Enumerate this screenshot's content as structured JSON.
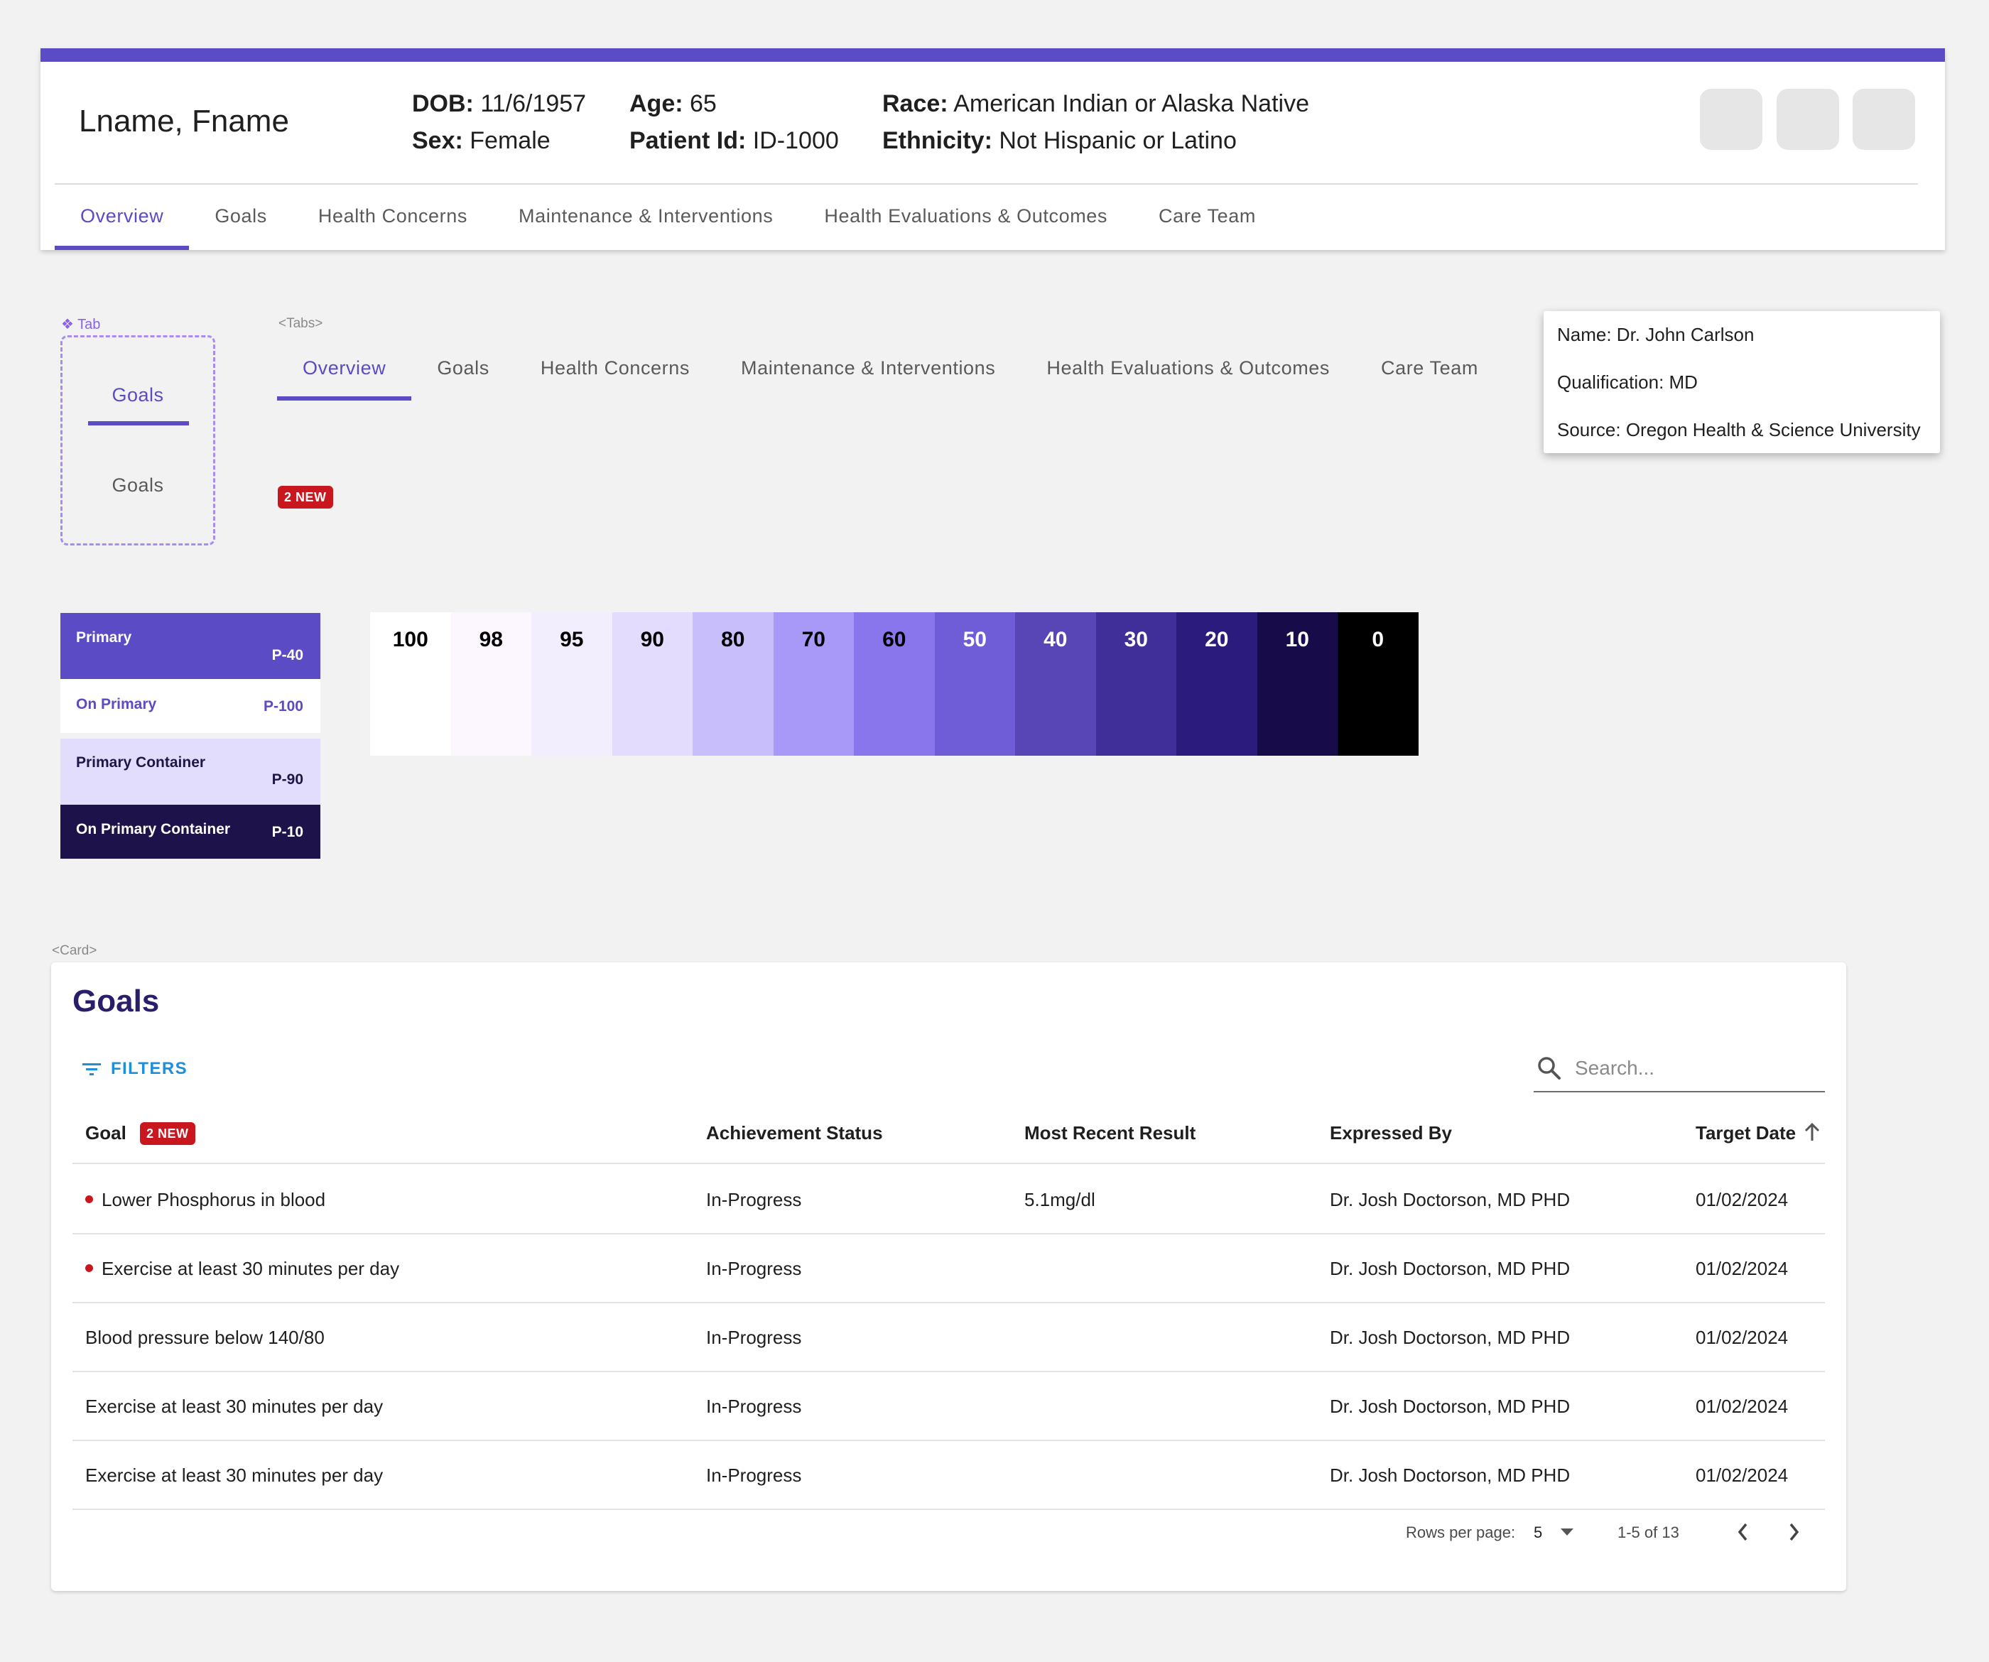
{
  "patient": {
    "name": "Lname, Fname",
    "dob_label": "DOB:",
    "dob": "11/6/1957",
    "sex_label": "Sex:",
    "sex": "Female",
    "age_label": "Age:",
    "age": "65",
    "id_label": "Patient Id:",
    "id": "ID-1000",
    "race_label": "Race:",
    "race": "American Indian or Alaska Native",
    "ethnicity_label": "Ethnicity:",
    "ethnicity": "Not Hispanic or Latino"
  },
  "header_tabs": [
    "Overview",
    "Goals",
    "Health Concerns",
    "Maintenance & Interventions",
    "Health Evaluations & Outcomes",
    "Care Team"
  ],
  "spec": {
    "tab_component_label": "❖ Tab",
    "tab_active": "Goals",
    "tab_inactive": "Goals",
    "tabs_component_label": "<Tabs>",
    "tabs": [
      "Overview",
      "Goals",
      "Health Concerns",
      "Maintenance & Interventions",
      "Health Evaluations & Outcomes",
      "Care Team"
    ],
    "badge": "2 NEW",
    "card_component_label": "<Card>"
  },
  "tooltip": {
    "name": "Name: Dr. John Carlson",
    "qualification": "Qualification: MD",
    "source": "Source: Oregon Health & Science University"
  },
  "roles": [
    {
      "name": "Primary",
      "code": "P-40",
      "bg": "#5b4bc4",
      "fg": "#ffffff"
    },
    {
      "name": "On Primary",
      "code": "P-100",
      "bg": "#ffffff",
      "fg": "#5b4bc4"
    },
    {
      "name": "Primary Container",
      "code": "P-90",
      "bg": "#e2dcfd",
      "fg": "#1f1646"
    },
    {
      "name": "On Primary Container",
      "code": "P-10",
      "bg": "#1d1249",
      "fg": "#ffffff"
    }
  ],
  "palette": [
    {
      "tone": "100",
      "bg": "#ffffff",
      "fg": "#000000"
    },
    {
      "tone": "98",
      "bg": "#fcf7ff",
      "fg": "#000000"
    },
    {
      "tone": "95",
      "bg": "#f3eefe",
      "fg": "#000000"
    },
    {
      "tone": "90",
      "bg": "#e4dcfd",
      "fg": "#000000"
    },
    {
      "tone": "80",
      "bg": "#c8befb",
      "fg": "#000000"
    },
    {
      "tone": "70",
      "bg": "#a898f8",
      "fg": "#000000"
    },
    {
      "tone": "60",
      "bg": "#8a76ec",
      "fg": "#000000"
    },
    {
      "tone": "50",
      "bg": "#6f5cd7",
      "fg": "#ffffff"
    },
    {
      "tone": "40",
      "bg": "#5846b7",
      "fg": "#ffffff"
    },
    {
      "tone": "30",
      "bg": "#402f99",
      "fg": "#ffffff"
    },
    {
      "tone": "20",
      "bg": "#2b1b7d",
      "fg": "#ffffff"
    },
    {
      "tone": "10",
      "bg": "#170b4a",
      "fg": "#ffffff"
    },
    {
      "tone": "0",
      "bg": "#000000",
      "fg": "#ffffff"
    }
  ],
  "goals": {
    "title": "Goals",
    "filters_label": "FILTERS",
    "search_placeholder": "Search...",
    "columns": {
      "goal": "Goal",
      "status": "Achievement Status",
      "result": "Most Recent Result",
      "by": "Expressed By",
      "date": "Target Date"
    },
    "badge": "2 NEW",
    "rows": [
      {
        "goal": "Lower Phosphorus in blood",
        "status": "In-Progress",
        "result": "5.1mg/dl",
        "by": "Dr. Josh Doctorson, MD PHD",
        "date": "01/02/2024",
        "new": true
      },
      {
        "goal": "Exercise at least 30 minutes per day",
        "status": "In-Progress",
        "result": "",
        "by": "Dr. Josh Doctorson, MD PHD",
        "date": "01/02/2024",
        "new": true
      },
      {
        "goal": "Blood pressure below 140/80",
        "status": "In-Progress",
        "result": "",
        "by": "Dr. Josh Doctorson, MD PHD",
        "date": "01/02/2024",
        "new": false
      },
      {
        "goal": "Exercise at least 30 minutes per day",
        "status": "In-Progress",
        "result": "",
        "by": "Dr. Josh Doctorson, MD PHD",
        "date": "01/02/2024",
        "new": false
      },
      {
        "goal": "Exercise at least 30 minutes per day",
        "status": "In-Progress",
        "result": "",
        "by": "Dr. Josh Doctorson, MD PHD",
        "date": "01/02/2024",
        "new": false
      }
    ],
    "rows_per_page_label": "Rows per page:",
    "rows_per_page": "5",
    "range": "1-5 of 13"
  },
  "colors": {
    "accent": "#5b4bc4",
    "badge": "#c8171e",
    "link": "#1d8fdb"
  }
}
